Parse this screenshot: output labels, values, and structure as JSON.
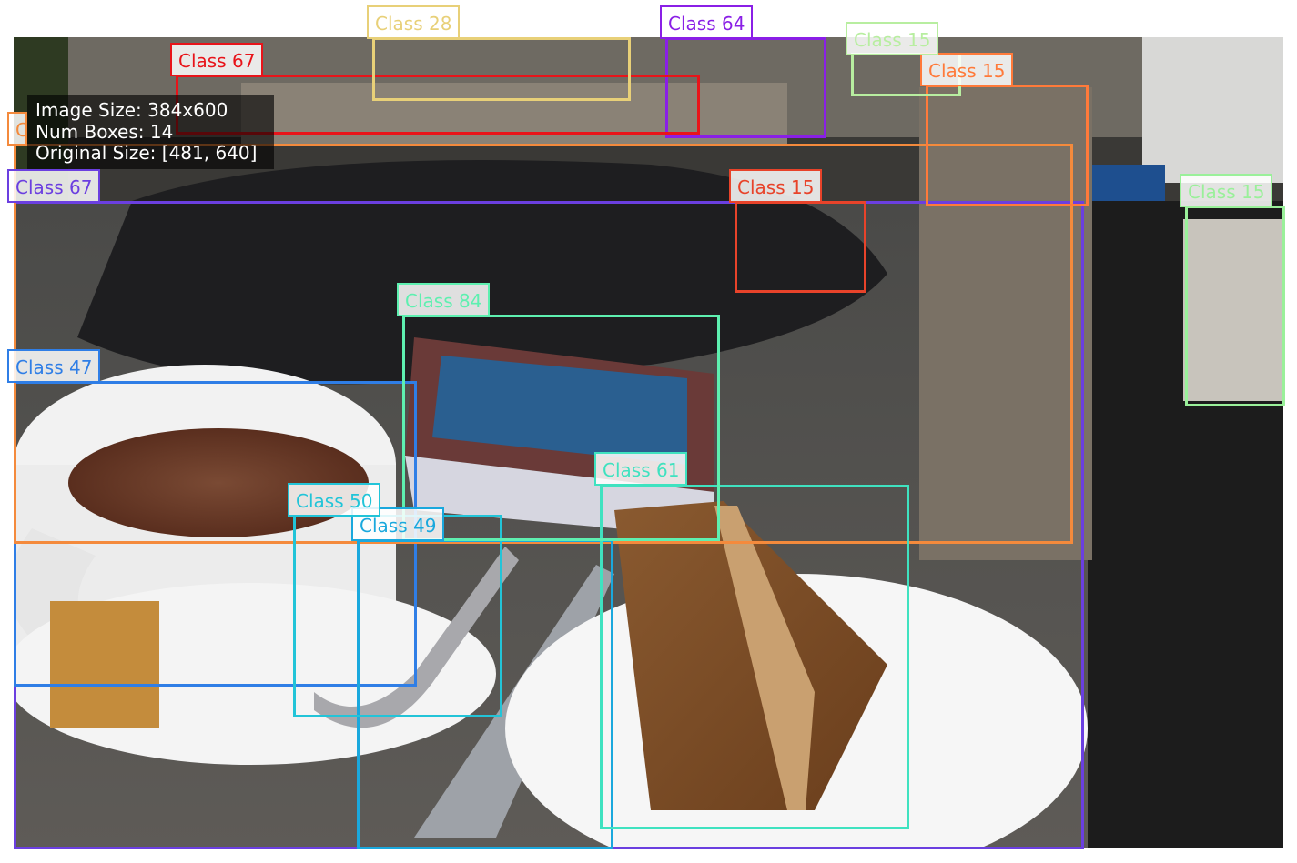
{
  "info": {
    "image_size": "Image Size: 384x600",
    "num_boxes": "Num Boxes: 14",
    "original_size": "Original Size: [481, 640]"
  },
  "detections": [
    {
      "label": "Class 67",
      "color": "#6b3fe0"
    },
    {
      "label": "Class 47",
      "color": "#2f7ee6"
    },
    {
      "label": "Class 15",
      "color": "#f48a3c"
    },
    {
      "label": "Class 49",
      "color": "#1aa8dd"
    },
    {
      "label": "Class 61",
      "color": "#3fe2c0"
    },
    {
      "label": "Class 50",
      "color": "#22c4d8"
    },
    {
      "label": "Class 84",
      "color": "#5ef0b0"
    },
    {
      "label": "Class 15",
      "color": "#e8432a"
    },
    {
      "label": "Class 15",
      "color": "#ff7a3a"
    },
    {
      "label": "Class 64",
      "color": "#8a1fe6"
    },
    {
      "label": "Class 67",
      "color": "#e8141a"
    },
    {
      "label": "Class 28",
      "color": "#e8d078"
    },
    {
      "label": "Class 15",
      "color": "#b8eea0"
    },
    {
      "label": "Class 15",
      "color": "#9af09a"
    }
  ]
}
